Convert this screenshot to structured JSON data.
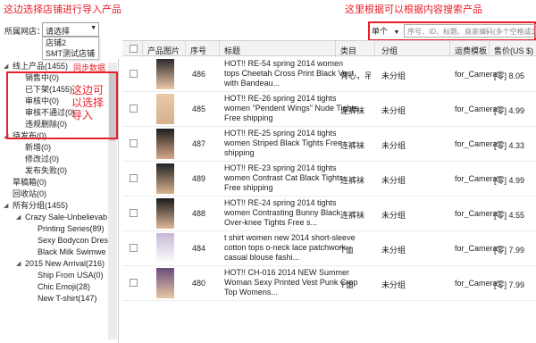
{
  "annotations": {
    "top_left": "这边选择店铺进行导入产品",
    "top_right": "这里根据可以根据内容搜索产品",
    "left_box": "这边可以选择导入",
    "left_link": "同步数据"
  },
  "store": {
    "label": "所属网店：",
    "selected": "请选择",
    "options": [
      "店铺2",
      "SMT测试店铺"
    ]
  },
  "tree": [
    {
      "label": "线上产品(1455)",
      "level": 0,
      "expanded": true
    },
    {
      "label": "销售中(0)",
      "level": 1
    },
    {
      "label": "已下架(1455)",
      "level": 1
    },
    {
      "label": "审核中(0)",
      "level": 1
    },
    {
      "label": "审核不通过(0)",
      "level": 1
    },
    {
      "label": "违规删除(0)",
      "level": 1
    },
    {
      "label": "待发布(0)",
      "level": 0,
      "expanded": true
    },
    {
      "label": "新增(0)",
      "level": 1
    },
    {
      "label": "修改过(0)",
      "level": 1
    },
    {
      "label": "发布失败(0)",
      "level": 1
    },
    {
      "label": "草稿箱(0)",
      "level": 0
    },
    {
      "label": "回收站(0)",
      "level": 0
    },
    {
      "label": "所有分组(1455)",
      "level": 0,
      "expanded": true
    },
    {
      "label": "Crazy Sale-Unbelievab",
      "level": 1,
      "expanded": true
    },
    {
      "label": "Printing Series(89)",
      "level": 2
    },
    {
      "label": "Sexy Bodycon Dres",
      "level": 2
    },
    {
      "label": "Black Milk Swimwe",
      "level": 2
    },
    {
      "label": "2015 New Arrival(216)",
      "level": 1,
      "expanded": true
    },
    {
      "label": "Ship From USA(0)",
      "level": 2
    },
    {
      "label": "Chic Emoji(28)",
      "level": 2
    },
    {
      "label": "New T-shirt(147)",
      "level": 2
    }
  ],
  "search": {
    "mode": "单个",
    "placeholder": "序号、ID、标题、商家编码(多个空格或逗"
  },
  "table": {
    "headers": [
      "产品图片",
      "序号",
      "标题",
      "类目",
      "分组",
      "运费模板",
      "售价(US $)"
    ],
    "rows": [
      {
        "num": "486",
        "title": "HOT!! RE-54 spring 2014 women tops Cheetah Cross Print Black Vest with Bandeau...",
        "category": "背心，吊带",
        "group": "未分组",
        "template": "for_Camera",
        "price": "[零] 8.05"
      },
      {
        "num": "485",
        "title": "HOT!! RE-26 spring 2014 tights women \"Pendent Wings\" Nude Tights Free shipping",
        "category": "连裤袜",
        "group": "未分组",
        "template": "for_Camera",
        "price": "[零] 4.99"
      },
      {
        "num": "487",
        "title": "HOT!! RE-25 spring 2014 tights women Striped Black Tights Free shipping",
        "category": "连裤袜",
        "group": "未分组",
        "template": "for_Camera",
        "price": "[零] 4.33"
      },
      {
        "num": "489",
        "title": "HOT!! RE-23 spring 2014 tights women Contrast Cat Black Tights Free shipping",
        "category": "连裤袜",
        "group": "未分组",
        "template": "for_Camera",
        "price": "[零] 4.99"
      },
      {
        "num": "488",
        "title": "HOT!! RE-24 spring 2014 tights women Contrasting Bunny Black Over-knee Tights Free s...",
        "category": "连裤袜",
        "group": "未分组",
        "template": "for_Camera",
        "price": "[零] 4.55"
      },
      {
        "num": "484",
        "title": "t shirt women new 2014 short-sleeve cotton tops o-neck lace patchwork casual blouse fashi...",
        "category": "T恤",
        "group": "未分组",
        "template": "for_Camera",
        "price": "[零] 7.99"
      },
      {
        "num": "480",
        "title": "HOT!! CH-016 2014 NEW Summer Woman Sexy Printed Vest Punk Crop Top Womens...",
        "category": "T恤",
        "group": "未分组",
        "template": "for_Camera",
        "price": "[零] 7.99"
      }
    ]
  }
}
